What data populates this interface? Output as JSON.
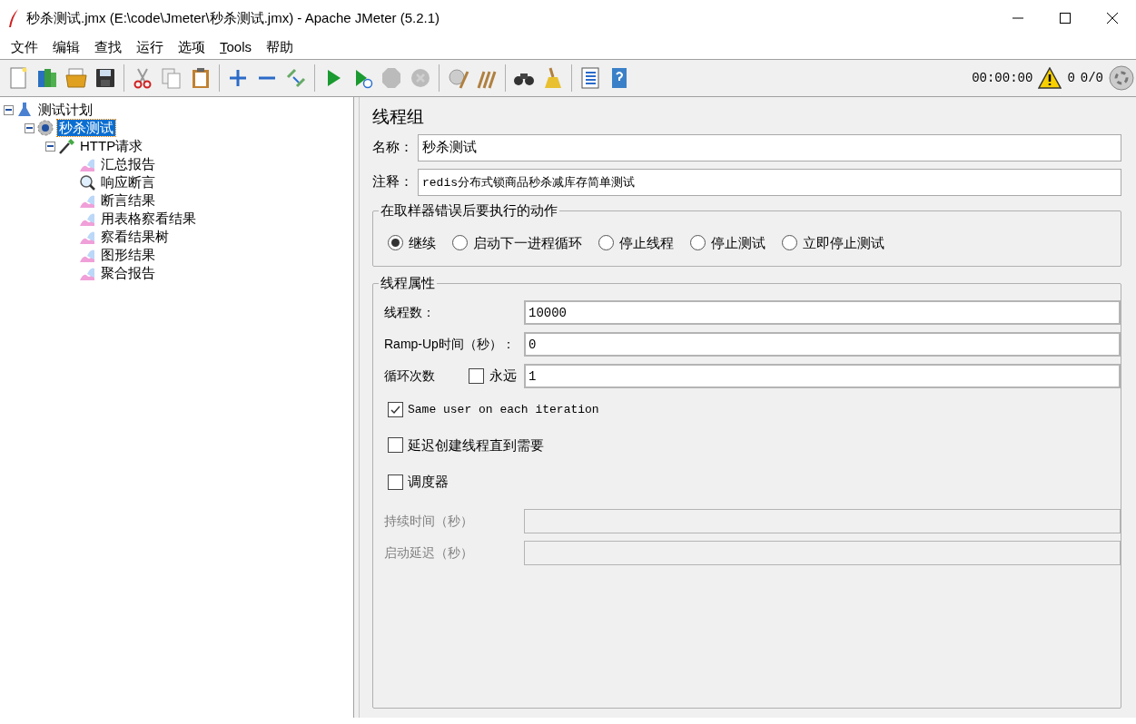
{
  "window": {
    "title": "秒杀测试.jmx (E:\\code\\Jmeter\\秒杀测试.jmx) - Apache JMeter (5.2.1)"
  },
  "menu": [
    {
      "label": "文件"
    },
    {
      "label": "编辑"
    },
    {
      "label": "查找"
    },
    {
      "label": "运行"
    },
    {
      "label": "选项"
    },
    {
      "label": "Tools",
      "mnemonic_underlined": true
    },
    {
      "label": "帮助"
    }
  ],
  "toolbar": {
    "groups": [
      [
        {
          "kind": "new",
          "disabled": false
        },
        {
          "kind": "templates",
          "disabled": false
        },
        {
          "kind": "open",
          "disabled": false
        },
        {
          "kind": "save",
          "disabled": false
        }
      ],
      [
        {
          "kind": "cut",
          "disabled": false
        },
        {
          "kind": "copy",
          "disabled": false
        },
        {
          "kind": "paste",
          "disabled": false
        }
      ],
      [
        {
          "kind": "expand",
          "disabled": false
        },
        {
          "kind": "collapse",
          "disabled": false
        },
        {
          "kind": "toggle",
          "disabled": false
        }
      ],
      [
        {
          "kind": "start",
          "disabled": false
        },
        {
          "kind": "start-no-pause",
          "disabled": false
        },
        {
          "kind": "stop",
          "disabled": true
        },
        {
          "kind": "shutdown",
          "disabled": true
        }
      ],
      [
        {
          "kind": "clear",
          "disabled": false
        },
        {
          "kind": "clear-all",
          "disabled": false
        }
      ],
      [
        {
          "kind": "search",
          "disabled": false
        },
        {
          "kind": "reset-search",
          "disabled": false
        }
      ],
      [
        {
          "kind": "functions",
          "disabled": false
        },
        {
          "kind": "help",
          "disabled": false
        }
      ]
    ],
    "timer": "00:00:00",
    "warnings": "0",
    "threads": "0/0"
  },
  "tree": [
    {
      "label": "测试计划",
      "kind": "plan",
      "selected": false,
      "expanded": true,
      "children": [
        {
          "label": "秒杀测试",
          "kind": "threadgroup",
          "selected": true,
          "expanded": true,
          "children": [
            {
              "label": "HTTP请求",
              "kind": "sampler",
              "selected": false,
              "expanded": true,
              "children": [
                {
                  "label": "汇总报告",
                  "kind": "listener",
                  "selected": false
                },
                {
                  "label": "响应断言",
                  "kind": "assertion",
                  "selected": false
                },
                {
                  "label": "断言结果",
                  "kind": "listener",
                  "selected": false
                },
                {
                  "label": "用表格察看结果",
                  "kind": "listener",
                  "selected": false
                },
                {
                  "label": "察看结果树",
                  "kind": "listener",
                  "selected": false
                },
                {
                  "label": "图形结果",
                  "kind": "listener",
                  "selected": false
                },
                {
                  "label": "聚合报告",
                  "kind": "listener",
                  "selected": false
                }
              ]
            }
          ]
        }
      ]
    }
  ],
  "panel": {
    "title": "线程组",
    "name": {
      "label": "名称：",
      "value": "秒杀测试"
    },
    "comment": {
      "label": "注释：",
      "value": "redis分布式锁商品秒杀减库存简单测试"
    },
    "error_action": {
      "legend": "在取样器错误后要执行的动作",
      "options": [
        {
          "label": "继续",
          "selected": true
        },
        {
          "label": "启动下一进程循环",
          "selected": false
        },
        {
          "label": "停止线程",
          "selected": false
        },
        {
          "label": "停止测试",
          "selected": false
        },
        {
          "label": "立即停止测试",
          "selected": false
        }
      ]
    },
    "thread_props": {
      "legend": "线程属性",
      "threads": {
        "label": "线程数：",
        "value": "10000"
      },
      "rampup": {
        "label": "Ramp-Up时间（秒）：",
        "value": "0"
      },
      "loops": {
        "label": "循环次数",
        "forever": {
          "label": "永远",
          "checked": false
        },
        "value": "1"
      },
      "checks": [
        {
          "label": "Same user on each iteration",
          "checked": true,
          "mono": true
        },
        {
          "label": "延迟创建线程直到需要",
          "checked": false,
          "mono": false
        },
        {
          "label": "调度器",
          "checked": false,
          "mono": false
        }
      ],
      "duration": {
        "label": "持续时间（秒）",
        "disabled": true
      },
      "delay": {
        "label": "启动延迟（秒）",
        "disabled": true
      }
    }
  }
}
